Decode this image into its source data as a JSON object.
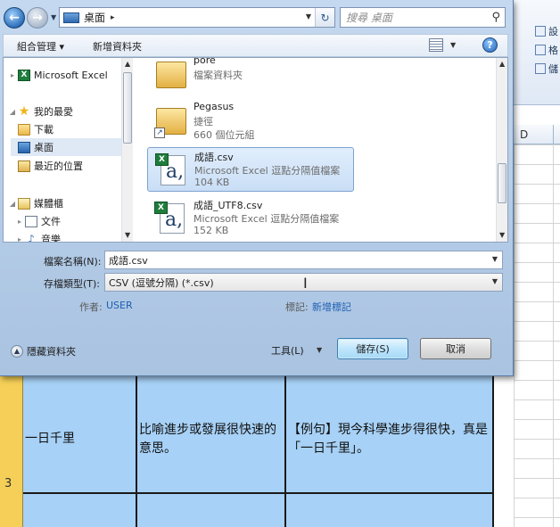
{
  "dialog": {
    "address": {
      "location": "桌面",
      "arrow": "▸"
    },
    "search": {
      "placeholder": "搜尋 桌面"
    },
    "toolbar": {
      "organize": "組合管理 ▾",
      "new_folder": "新增資料夾"
    },
    "nav": {
      "items": [
        {
          "label": "Microsoft Excel",
          "icon": "excel-icon"
        },
        {
          "label": "我的最愛",
          "icon": "star-icon"
        },
        {
          "label": "下載",
          "icon": "folder-icon"
        },
        {
          "label": "桌面",
          "icon": "desktop-icon"
        },
        {
          "label": "最近的位置",
          "icon": "recent-icon"
        },
        {
          "label": "媒體櫃",
          "icon": "library-icon"
        },
        {
          "label": "文件",
          "icon": "document-icon"
        },
        {
          "label": "音樂",
          "icon": "music-icon"
        }
      ]
    },
    "files": [
      {
        "name": "pore",
        "type": "檔案資料夾",
        "size": ""
      },
      {
        "name": "Pegasus",
        "type": "捷徑",
        "size": "660 個位元組"
      },
      {
        "name": "成語.csv",
        "type": "Microsoft Excel 逗點分隔值檔案",
        "size": "104 KB"
      },
      {
        "name": "成語_UTF8.csv",
        "type": "Microsoft Excel 逗點分隔值檔案",
        "size": "152 KB"
      }
    ],
    "filename_label": "檔案名稱(N):",
    "filename_value": "成語.csv",
    "filetype_label": "存檔類型(T):",
    "filetype_value": "CSV (逗號分隔) (*.csv)",
    "author_label": "作者:",
    "author_value": "USER",
    "tags_label": "標記:",
    "tags_value": "新增標記",
    "hide_folders": "隱藏資料夾",
    "tools": "工具(L)",
    "save": "儲存(S)",
    "cancel": "取消"
  },
  "excel": {
    "ribbon": [
      "設",
      "格",
      "儲"
    ],
    "column_d": "D",
    "row_number": "3",
    "cells": {
      "idiom": "一日千里",
      "meaning": "比喻進步或發展很快速的意思。",
      "example": "【例句】現今科學進步得很快，真是「一日千里」。"
    }
  }
}
